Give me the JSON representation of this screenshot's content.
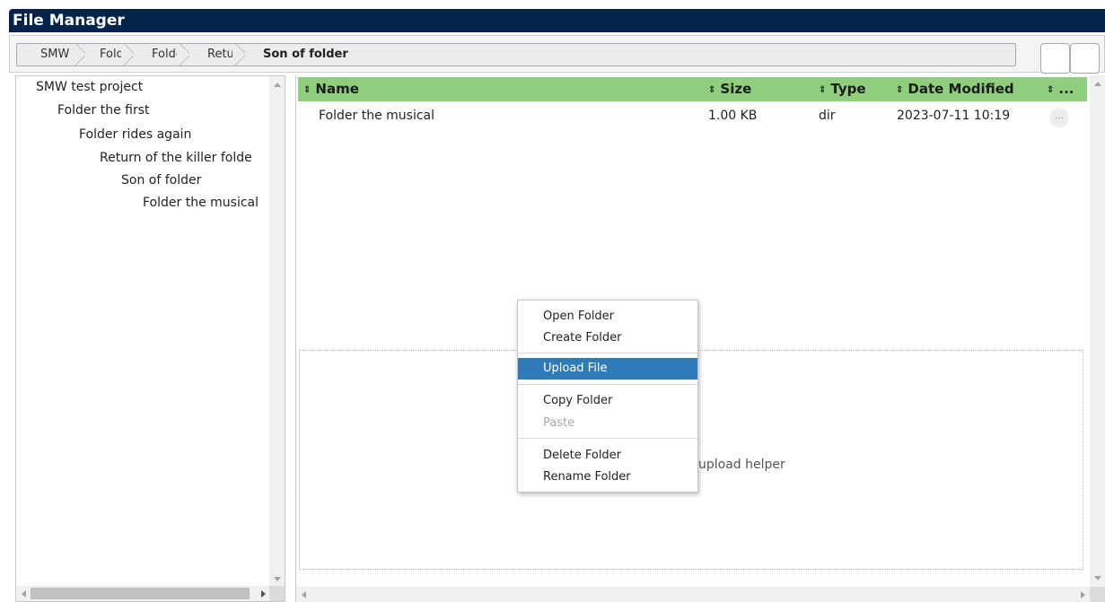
{
  "app": {
    "title": "File Manager"
  },
  "breadcrumb": {
    "items": [
      {
        "label": "SMW"
      },
      {
        "label": "Folder the first"
      },
      {
        "label": "Folder rides again"
      },
      {
        "label": "Return of the killer folder"
      }
    ],
    "current": "Son of folder"
  },
  "tree": {
    "items": [
      {
        "label": "SMW test project",
        "level": 0
      },
      {
        "label": "Folder the first",
        "level": 1
      },
      {
        "label": "Folder rides again",
        "level": 2
      },
      {
        "label": "Return of the killer folde",
        "level": 3
      },
      {
        "label": "Son of folder",
        "level": 4
      },
      {
        "label": "Folder the musical",
        "level": 5
      }
    ]
  },
  "grid": {
    "sort_icon": "⇕",
    "columns": [
      {
        "label": "Name"
      },
      {
        "label": "Size"
      },
      {
        "label": "Type"
      },
      {
        "label": "Date Modified"
      },
      {
        "label": "..."
      }
    ],
    "rows": [
      {
        "name": "Folder the musical",
        "size": "1.00 KB",
        "type": "dir",
        "modified": "2023-07-11 10:19",
        "more": "..."
      }
    ]
  },
  "dropzone": {
    "text": "upload helper"
  },
  "context_menu": {
    "items": [
      {
        "label": "Open Folder"
      },
      {
        "label": "Create Folder"
      },
      {
        "label": "Upload File",
        "active": true
      },
      {
        "label": "Copy Folder"
      },
      {
        "label": "Paste",
        "disabled": true
      },
      {
        "label": "Delete Folder"
      },
      {
        "label": "Rename Folder"
      }
    ]
  },
  "colors": {
    "titlebar": "#03244a",
    "grid_header": "#8fce7d",
    "menu_highlight": "#2f7bba"
  }
}
